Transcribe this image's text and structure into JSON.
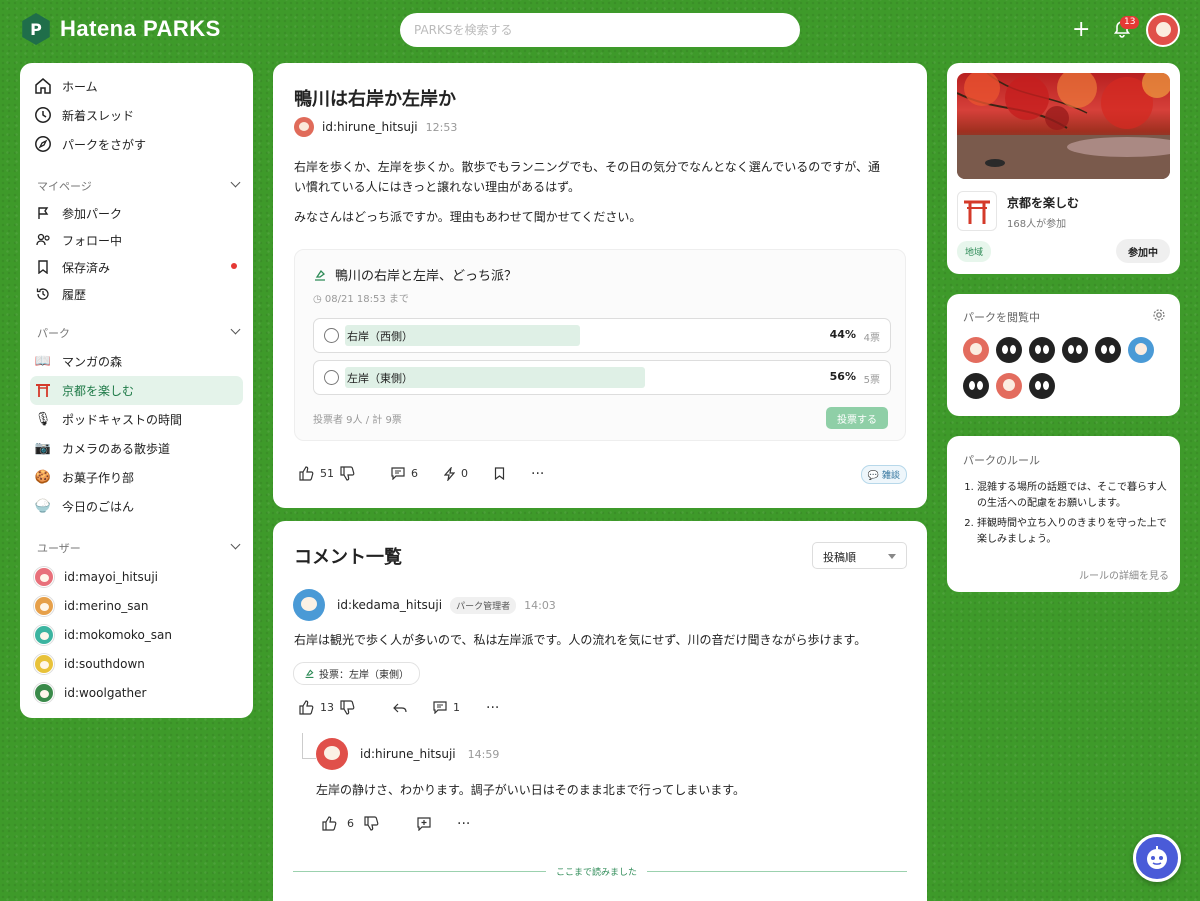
{
  "header": {
    "brand": "Hatena PARKS",
    "logo_letter": "P",
    "search_placeholder": "PARKSを検索する",
    "notification_count": "13"
  },
  "sidebar": {
    "main": [
      {
        "label": "ホーム",
        "icon": "home-icon"
      },
      {
        "label": "新着スレッド",
        "icon": "clock-icon"
      },
      {
        "label": "パークをさがす",
        "icon": "compass-icon"
      }
    ],
    "mypage_title": "マイページ",
    "mypage": [
      {
        "label": "参加パーク",
        "icon": "flag-icon"
      },
      {
        "label": "フォロー中",
        "icon": "users-icon"
      },
      {
        "label": "保存済み",
        "icon": "bookmark-icon"
      },
      {
        "label": "履歴",
        "icon": "history-icon"
      }
    ],
    "park_title": "パーク",
    "parks": [
      {
        "label": "マンガの森",
        "emoji": "📖"
      },
      {
        "label": "京都を楽しむ",
        "emoji": "⛩"
      },
      {
        "label": "ポッドキャストの時間",
        "emoji": "🎙"
      },
      {
        "label": "カメラのある散歩道",
        "emoji": "📷"
      },
      {
        "label": "お菓子作り部",
        "emoji": "🍪"
      },
      {
        "label": "今日のごはん",
        "emoji": "🍚"
      }
    ],
    "user_title": "ユーザー",
    "users": [
      {
        "label": "id:mayoi_hitsuji",
        "color": "#e8707a"
      },
      {
        "label": "id:merino_san",
        "color": "#e6a04a"
      },
      {
        "label": "id:mokomoko_san",
        "color": "#3cb4a0"
      },
      {
        "label": "id:southdown",
        "color": "#e8c23a"
      },
      {
        "label": "id:woolgather",
        "color": "#3a8a4a"
      }
    ]
  },
  "post": {
    "title": "鴨川は右岸か左岸か",
    "author": "id:hirune_hitsuji",
    "time": "12:53",
    "body1_line1": "右岸を歩くか、左岸を歩くか。散歩でもランニングでも、その日の気分でなんとなく選んでいるのですが、通",
    "body1_line2": "い慣れている人にはきっと譲れない理由があるはず。",
    "body2": "みなさんはどっち派ですか。理由もあわせて聞かせてください。",
    "poll": {
      "title": "鴨川の右岸と左岸、どっち派？",
      "deadline": "08/21 18:53 まで",
      "options": [
        {
          "label": "右岸（西側）",
          "percent": "44%",
          "votes": "4票",
          "share": 0.44
        },
        {
          "label": "左岸（東側）",
          "percent": "56%",
          "votes": "5票",
          "share": 0.56
        }
      ],
      "footer": "投票者 9人 / 計 9票",
      "vote_button": "投票する"
    },
    "likes": "51",
    "comments": "6",
    "boosts": "0",
    "tag": "雑談"
  },
  "comments": {
    "title": "コメント一覧",
    "sort": "投稿順",
    "items": [
      {
        "author": "id:kedama_hitsuji",
        "role": "パーク管理者",
        "time": "14:03",
        "text": "右岸は観光で歩く人が多いので、私は左岸派です。人の流れを気にせず、川の音だけ聞きながら歩けます。",
        "vote": "投票：左岸（東側）",
        "likes": "13",
        "replies": "1"
      }
    ],
    "reply": {
      "author": "id:hirune_hitsuji",
      "time": "14:59",
      "text": "左岸の静けさ、わかります。調子がいい日はそのまま北まで行ってしまいます。",
      "likes": "6"
    },
    "read_marker": "ここまで読みました"
  },
  "park_card": {
    "name": "京都を楽しむ",
    "members": "168人が参加",
    "category": "地域",
    "join_label": "参加中"
  },
  "viewers": {
    "title": "パークを閲覧中",
    "avatars": [
      "pink-sheep",
      "eyes",
      "eyes",
      "eyes",
      "eyes",
      "blue-sheep",
      "eyes",
      "pink-sheep",
      "eyes"
    ]
  },
  "rules": {
    "title": "パークのルール",
    "items": [
      "混雑する場所の話題では、そこで暮らす人の生活への配慮をお願いします。",
      "拝観時間や立ち入りのきまりを守った上で楽しみましょう。"
    ],
    "more": "ルールの詳細を見る"
  }
}
